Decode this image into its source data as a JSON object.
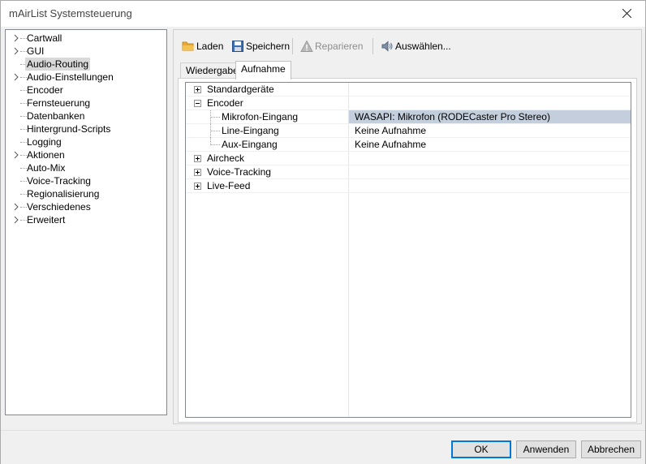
{
  "window": {
    "title": "mAirList Systemsteuerung"
  },
  "sidebar": {
    "items": [
      {
        "label": "Cartwall",
        "expandable": true
      },
      {
        "label": "GUI",
        "expandable": true
      },
      {
        "label": "Audio-Routing",
        "expandable": false,
        "selected": true
      },
      {
        "label": "Audio-Einstellungen",
        "expandable": true
      },
      {
        "label": "Encoder",
        "expandable": false
      },
      {
        "label": "Fernsteuerung",
        "expandable": false
      },
      {
        "label": "Datenbanken",
        "expandable": false
      },
      {
        "label": "Hintergrund-Scripts",
        "expandable": false
      },
      {
        "label": "Logging",
        "expandable": false
      },
      {
        "label": "Aktionen",
        "expandable": true
      },
      {
        "label": "Auto-Mix",
        "expandable": false
      },
      {
        "label": "Voice-Tracking",
        "expandable": false
      },
      {
        "label": "Regionalisierung",
        "expandable": false
      },
      {
        "label": "Verschiedenes",
        "expandable": true
      },
      {
        "label": "Erweitert",
        "expandable": true
      }
    ]
  },
  "toolbar": {
    "load_label": "Laden",
    "save_label": "Speichern",
    "repair_label": "Reparieren",
    "select_label": "Auswählen..."
  },
  "tabs": [
    {
      "label": "Wiedergabe",
      "active": false
    },
    {
      "label": "Aufnahme",
      "active": true
    }
  ],
  "grid": {
    "rows": [
      {
        "name": "Standardgeräte",
        "value": "",
        "level": 0,
        "state": "collapsed"
      },
      {
        "name": "Encoder",
        "value": "",
        "level": 0,
        "state": "expanded"
      },
      {
        "name": "Mikrofon-Eingang",
        "value": "WASAPI: Mikrofon (RODECaster Pro Stereo)",
        "level": 1,
        "selected": true
      },
      {
        "name": "Line-Eingang",
        "value": "Keine Aufnahme",
        "level": 1
      },
      {
        "name": "Aux-Eingang",
        "value": "Keine Aufnahme",
        "level": 1
      },
      {
        "name": "Aircheck",
        "value": "",
        "level": 0,
        "state": "collapsed"
      },
      {
        "name": "Voice-Tracking",
        "value": "",
        "level": 0,
        "state": "collapsed"
      },
      {
        "name": "Live-Feed",
        "value": "",
        "level": 0,
        "state": "collapsed"
      }
    ]
  },
  "footer": {
    "ok_label": "OK",
    "apply_label": "Anwenden",
    "cancel_label": "Abbrechen"
  },
  "colors": {
    "selection": "#c4cfdd",
    "sidebar_selection": "#d9d9d9",
    "default_button_border": "#0078d7"
  }
}
